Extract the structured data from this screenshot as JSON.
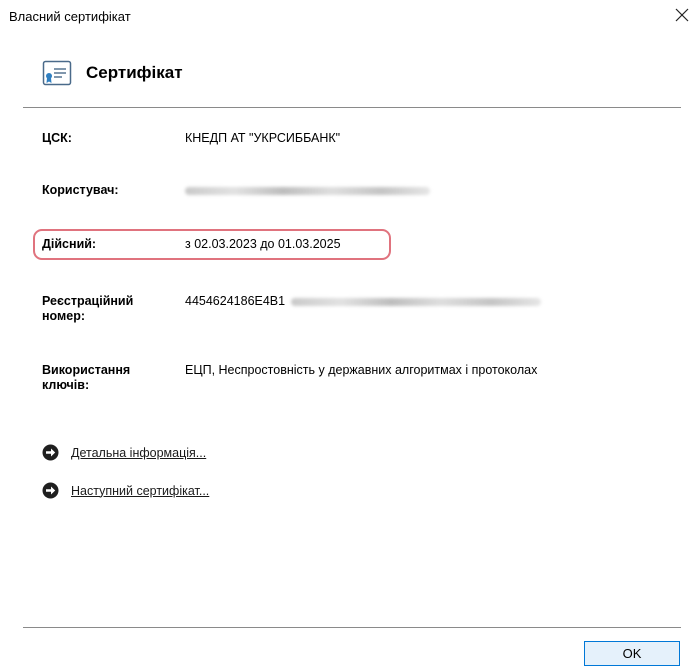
{
  "window": {
    "title": "Власний сертифікат"
  },
  "header": {
    "title": "Сертифікат"
  },
  "fields": {
    "csk": {
      "label": "ЦСК:",
      "value": "КНЕДП АТ \"УКРСИББАНК\""
    },
    "user": {
      "label": "Користувач:"
    },
    "valid": {
      "label": "Дійсний:",
      "value": "з 02.03.2023 до 01.03.2025"
    },
    "reg": {
      "label": "Реєстраційний номер:",
      "value": "4454624186E4B1"
    },
    "usage": {
      "label": "Використання ключів:",
      "value": "ЕЦП, Неспростовність у державних алгоритмах і протоколах"
    }
  },
  "links": {
    "details": "Детальна інформація...",
    "next": "Наступний сертифікат..."
  },
  "footer": {
    "ok_label": "OK"
  },
  "colors": {
    "highlight": "#e0737e",
    "ok_border": "#0078d7",
    "ok_bg": "#e5f1fb"
  }
}
